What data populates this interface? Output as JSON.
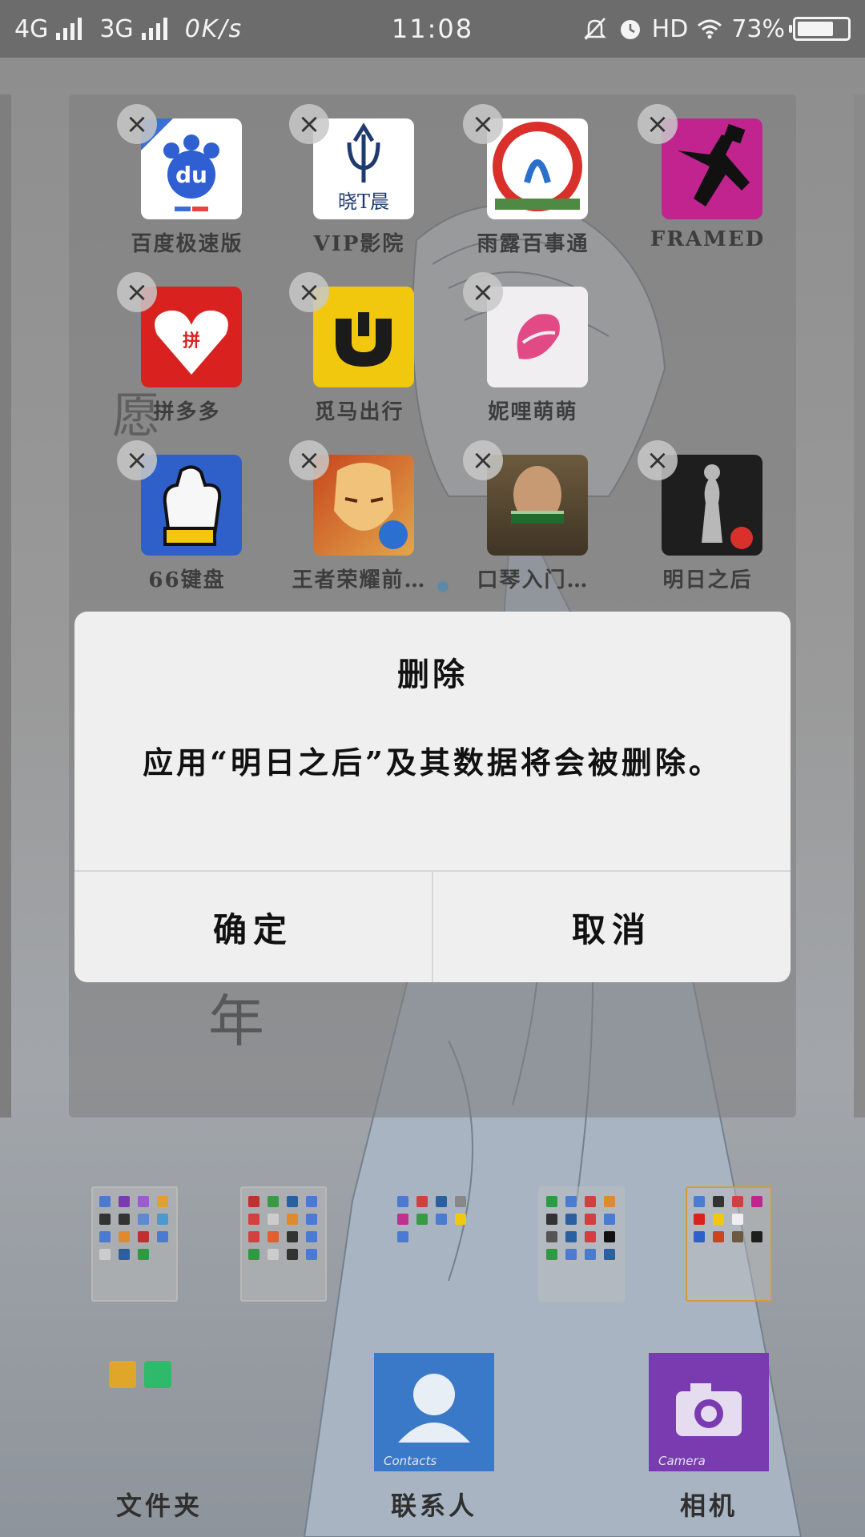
{
  "status_bar": {
    "network_1": "4G",
    "network_2": "3G",
    "speed": "0K/s",
    "time": "11:08",
    "hd": "HD",
    "battery": "73%",
    "battery_level": 0.73,
    "icons": [
      "mute-bell-icon",
      "alarm-icon",
      "wifi-icon"
    ]
  },
  "folder": {
    "apps": [
      {
        "label": "百度极速版",
        "icon": "baidu-icon"
      },
      {
        "label": "VIP影院",
        "icon": "vip-cinema-icon"
      },
      {
        "label": "雨露百事通",
        "icon": "yulu-icon"
      },
      {
        "label": "FRAMED",
        "icon": "framed-icon"
      },
      {
        "label": "拼多多",
        "icon": "pinduoduo-icon"
      },
      {
        "label": "觅马出行",
        "icon": "mima-icon"
      },
      {
        "label": "妮哩萌萌",
        "icon": "nili-icon"
      },
      {
        "label": "66键盘",
        "icon": "keyboard66-icon"
      },
      {
        "label": "王者荣耀前…",
        "icon": "honor-of-kings-icon"
      },
      {
        "label": "口琴入门…",
        "icon": "harmonica-icon"
      },
      {
        "label": "明日之后",
        "icon": "lifeafter-icon"
      }
    ],
    "delete_symbol": "×"
  },
  "dialog": {
    "title": "删除",
    "message": "应用“明日之后”及其数据将会被删除。",
    "confirm": "确定",
    "cancel": "取消"
  },
  "dock": {
    "folder_label": "文件夹",
    "contacts_label": "联系人",
    "contacts_tile_text": "Contacts",
    "camera_label": "相机",
    "camera_tile_text": "Camera"
  },
  "colors": {
    "dialog_bg": "#efefef",
    "contacts_tile": "#3a78c8",
    "camera_tile": "#7a3bb0",
    "current_page_border": "#d79a3a"
  }
}
